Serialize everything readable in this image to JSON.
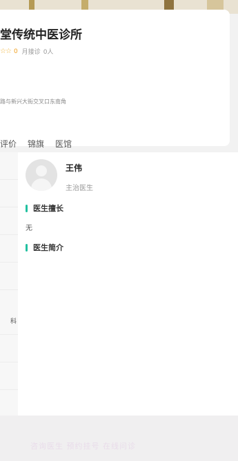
{
  "clinic": {
    "name": "堂传统中医诊所",
    "stars": "☆☆",
    "rating": "0",
    "monthly_label": "月接诊",
    "monthly_count": "0人",
    "address": "路与新兴大街交叉口东南角"
  },
  "tabs": [
    "评价",
    "锦旗",
    "医馆"
  ],
  "sidebar": {
    "items": [
      "",
      "",
      "",
      "",
      "",
      "科",
      "",
      ""
    ]
  },
  "doctor": {
    "name": "王伟",
    "title": "主治医生"
  },
  "sections": {
    "specialty_title": "医生擅长",
    "specialty_text": "无",
    "intro_title": "医生简介"
  },
  "footer": {
    "text": "咨询医生 预约挂号 在线问诊"
  },
  "colors": {
    "accent": "#21c0a0",
    "star": "#f0b53a"
  }
}
